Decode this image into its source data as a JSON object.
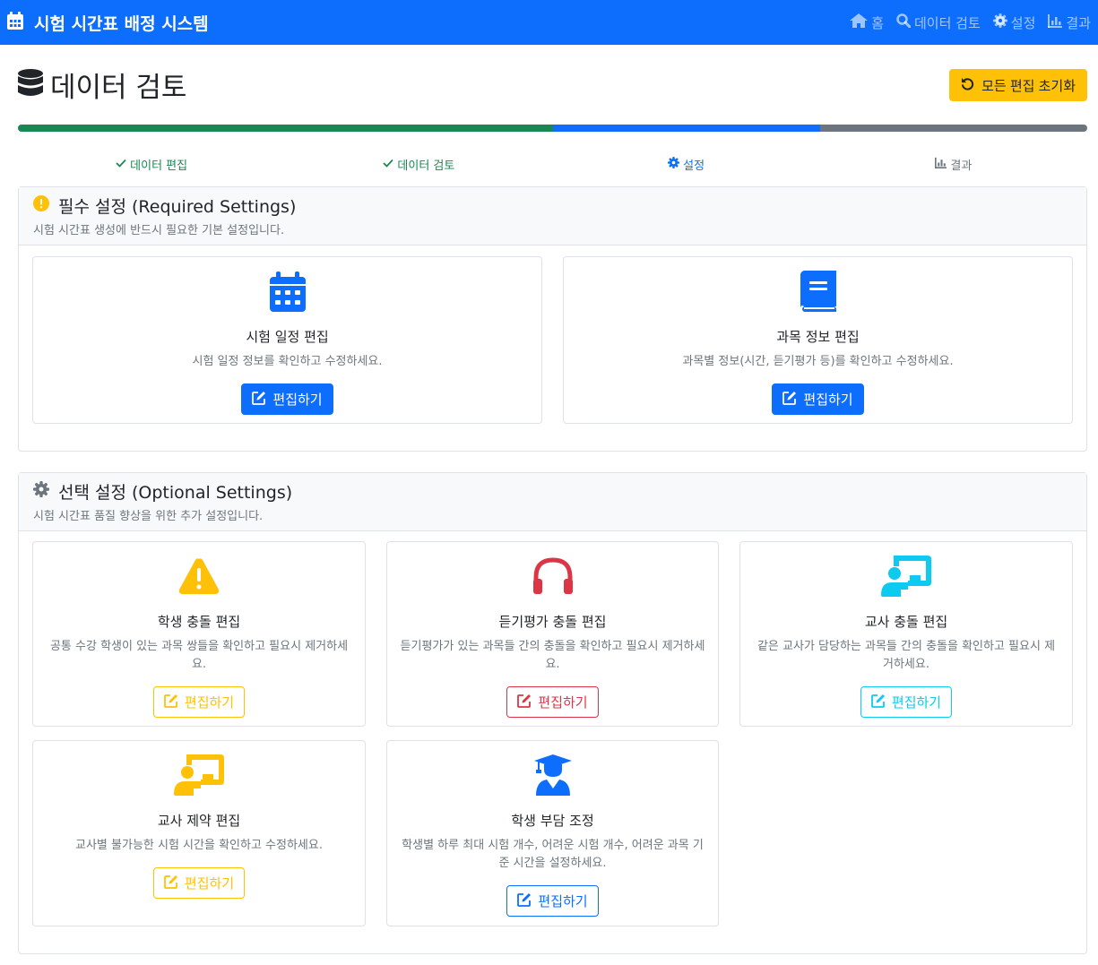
{
  "navbar": {
    "brand": "시험 시간표 배정 시스템",
    "links": [
      {
        "label": "홈",
        "icon": "home-icon"
      },
      {
        "label": "데이터 검토",
        "icon": "search-icon"
      },
      {
        "label": "설정",
        "icon": "gear-icon"
      },
      {
        "label": "결과",
        "icon": "chart-icon"
      }
    ]
  },
  "header": {
    "title": "데이터 검토",
    "reset_label": "모든 편집 초기화"
  },
  "progress": {
    "segments": [
      {
        "value": 0.5,
        "color": "#198754"
      },
      {
        "value": 0.25,
        "color": "#0d6efd"
      },
      {
        "value": 0.25,
        "color": "#6c757d"
      }
    ]
  },
  "steps": [
    {
      "label": "데이터 편집",
      "status": "done"
    },
    {
      "label": "데이터 검토",
      "status": "done"
    },
    {
      "label": "설정",
      "status": "active"
    },
    {
      "label": "결과",
      "status": "todo"
    }
  ],
  "required": {
    "title": "필수 설정 (Required Settings)",
    "subtitle": "시험 시간표 생성에 반드시 필요한 기본 설정입니다.",
    "cards": [
      {
        "title": "시험 일정 편집",
        "desc": "시험 일정 정보를 확인하고 수정하세요.",
        "button": "편집하기",
        "icon": "calendar-icon"
      },
      {
        "title": "과목 정보 편집",
        "desc": "과목별 정보(시간, 듣기평가 등)를 확인하고 수정하세요.",
        "button": "편집하기",
        "icon": "book-icon"
      }
    ]
  },
  "optional": {
    "title": "선택 설정 (Optional Settings)",
    "subtitle": "시험 시간표 품질 향상을 위한 추가 설정입니다.",
    "cards": [
      {
        "title": "학생 충돌 편집",
        "desc": "공통 수강 학생이 있는 과목 쌍들을 확인하고 필요시 제거하세요.",
        "button": "편집하기",
        "icon": "warning-icon"
      },
      {
        "title": "듣기평가 충돌 편집",
        "desc": "듣기평가가 있는 과목들 간의 충돌을 확인하고 필요시 제거하세요.",
        "button": "편집하기",
        "icon": "headphones-icon"
      },
      {
        "title": "교사 충돌 편집",
        "desc": "같은 교사가 담당하는 과목들 간의 충돌을 확인하고 필요시 제거하세요.",
        "button": "편집하기",
        "icon": "teacher-icon"
      },
      {
        "title": "교사 제약 편집",
        "desc": "교사별 불가능한 시험 시간을 확인하고 수정하세요.",
        "button": "편집하기",
        "icon": "teacher-icon"
      },
      {
        "title": "학생 부담 조정",
        "desc": "학생별 하루 최대 시험 개수, 어려운 시험 개수, 어려운 과목 기준 시간을 설정하세요.",
        "button": "편집하기",
        "icon": "graduate-icon"
      }
    ]
  }
}
